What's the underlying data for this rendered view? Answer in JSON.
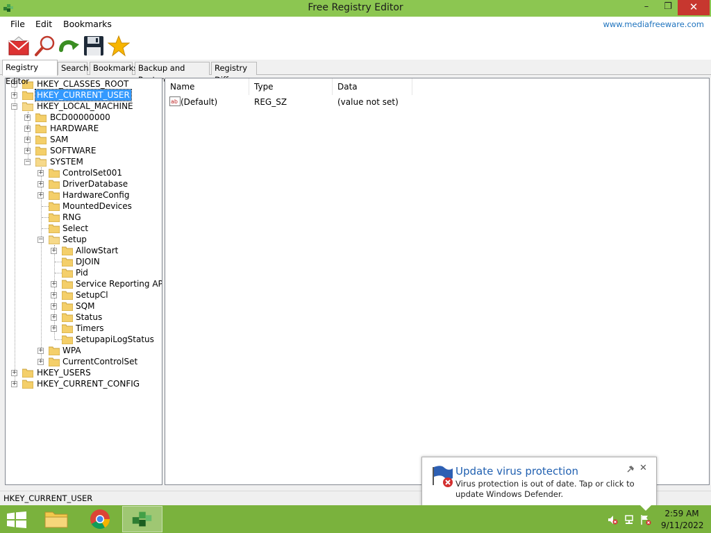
{
  "window": {
    "title": "Free Registry Editor",
    "minimize": "–",
    "restore": "❐",
    "close": "✕"
  },
  "menu": {
    "file": "File",
    "edit": "Edit",
    "bookmarks": "Bookmarks",
    "website": "www.mediafreeware.com"
  },
  "toolbar": [
    "mail-icon",
    "magnifier-icon",
    "refresh-arrow-icon",
    "save-disk-icon",
    "star-icon"
  ],
  "tabs": {
    "registry_editor": "Registry Editor",
    "search": "Search",
    "bookmarks": "Bookmarks",
    "backup_restore": "Backup and Restore",
    "registry_diff": "Registry Diff"
  },
  "tree": {
    "hkcr": "HKEY_CLASSES_ROOT",
    "hkcu": "HKEY_CURRENT_USER",
    "hklm": "HKEY_LOCAL_MACHINE",
    "bcd": "BCD00000000",
    "hardware": "HARDWARE",
    "sam": "SAM",
    "software": "SOFTWARE",
    "system": "SYSTEM",
    "controlset001": "ControlSet001",
    "driverdatabase": "DriverDatabase",
    "hardwareconfig": "HardwareConfig",
    "mounteddevices": "MountedDevices",
    "rng": "RNG",
    "select": "Select",
    "setup": "Setup",
    "allowstart": "AllowStart",
    "djoin": "DJOIN",
    "pid": "Pid",
    "servicereporting": "Service Reporting API",
    "setupcl": "SetupCl",
    "sqm": "SQM",
    "status": "Status",
    "timers": "Timers",
    "setupapilogstatus": "SetupapiLogStatus",
    "wpa": "WPA",
    "currentcontrolset": "CurrentControlSet",
    "hku": "HKEY_USERS",
    "hkcc": "HKEY_CURRENT_CONFIG"
  },
  "values_table": {
    "headers": {
      "name": "Name",
      "type": "Type",
      "data": "Data"
    },
    "rows": [
      {
        "name": "(Default)",
        "type": "REG_SZ",
        "data": "(value not set)"
      }
    ]
  },
  "status_bar": "HKEY_CURRENT_USER",
  "notification": {
    "title": "Update virus protection",
    "body": "Virus protection is out of date. Tap or click to update Windows Defender.",
    "close": "✕"
  },
  "taskbar": {
    "time": "2:59 AM",
    "date": "9/11/2022"
  },
  "colors": {
    "titlebar": "#8cc651",
    "taskbar": "#7ab23d",
    "selection": "#3399ff",
    "link": "#1e73be"
  }
}
